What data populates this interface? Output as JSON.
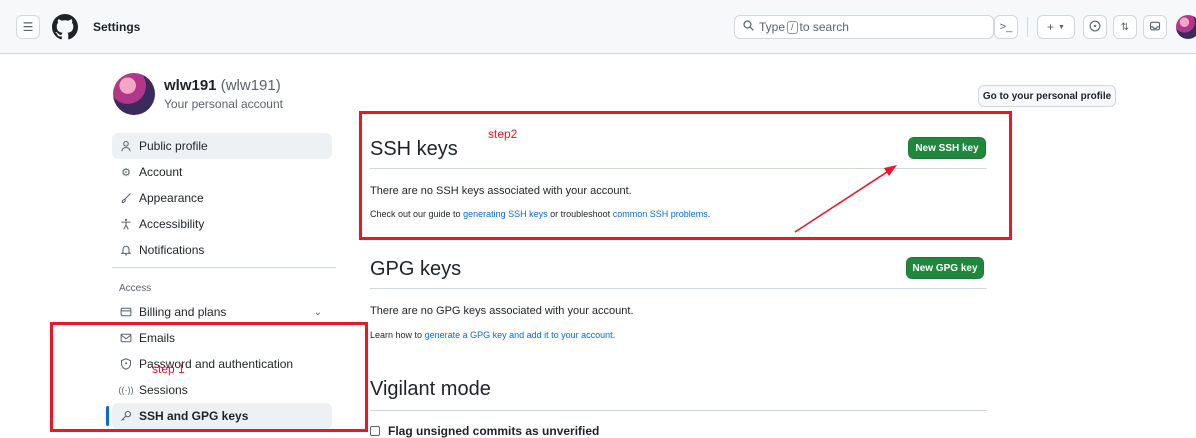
{
  "header": {
    "title": "Settings",
    "search_prefix": "Type",
    "search_key": "/",
    "search_suffix": "to search"
  },
  "profile": {
    "name": "wlw191",
    "handle": "(wlw191)",
    "subtitle": "Your personal account",
    "go_to_profile_label": "Go to your personal profile"
  },
  "sidebar": {
    "items": [
      {
        "label": "Public profile",
        "icon": "person-icon"
      },
      {
        "label": "Account",
        "icon": "gear-icon"
      },
      {
        "label": "Appearance",
        "icon": "paintbrush-icon"
      },
      {
        "label": "Accessibility",
        "icon": "accessibility-icon"
      },
      {
        "label": "Notifications",
        "icon": "bell-icon"
      }
    ],
    "access_heading": "Access",
    "access_items": [
      {
        "label": "Billing and plans",
        "icon": "credit-card-icon"
      },
      {
        "label": "Emails",
        "icon": "mail-icon"
      },
      {
        "label": "Password and authentication",
        "icon": "shield-lock-icon"
      },
      {
        "label": "Sessions",
        "icon": "broadcast-icon"
      },
      {
        "label": "SSH and GPG keys",
        "icon": "key-icon"
      }
    ]
  },
  "ssh": {
    "title": "SSH keys",
    "new_button": "New SSH key",
    "empty_text": "There are no SSH keys associated with your account.",
    "guide_prefix": "Check out our guide to",
    "guide_link": "generating SSH keys",
    "guide_middle": "or troubleshoot",
    "guide_link2": "common SSH problems",
    "guide_end": "."
  },
  "gpg": {
    "title": "GPG keys",
    "new_button": "New GPG key",
    "empty_text": "There are no GPG keys associated with your account.",
    "learn_prefix": "Learn how to",
    "learn_link": "generate a GPG key and add it to your account",
    "learn_end": "."
  },
  "vigilant": {
    "title": "Vigilant mode",
    "checkbox_label": "Flag unsigned commits as unverified"
  },
  "annotations": {
    "step1": "step 1",
    "step2": "step2",
    "color": "#e8182c"
  },
  "colors": {
    "primary_button": "#1f883d",
    "link": "#0969da",
    "active_indicator": "#0969da"
  }
}
